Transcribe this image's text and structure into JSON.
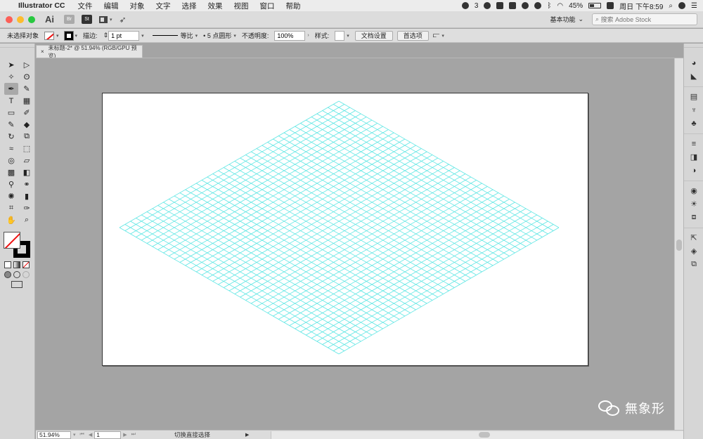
{
  "menubar": {
    "app_name": "Illustrator CC",
    "items": [
      "文件",
      "编辑",
      "对象",
      "文字",
      "选择",
      "效果",
      "视图",
      "窗口",
      "帮助"
    ],
    "wechat_count": "3",
    "battery": "45%",
    "clock": "周日 下午8:59"
  },
  "titlebar": {
    "app_badge": "Ai",
    "bridge_label": "Br",
    "stock_label": "St",
    "workspace": "基本功能",
    "search_placeholder": "搜索 Adobe Stock"
  },
  "controlbar": {
    "selection": "未选择对象",
    "stroke_label": "描边:",
    "stroke_weight": "1 pt",
    "profile": "等比",
    "brush": "5 点圆形",
    "opacity_label": "不透明度:",
    "opacity": "100%",
    "style_label": "样式:",
    "doc_setup": "文档设置",
    "preferences": "首选项"
  },
  "document": {
    "tab_title": "未标题-2* @ 51.94% (RGB/GPU 预览)",
    "close": "×"
  },
  "grid": {
    "color": "#5ee6e4",
    "divisions": 40
  },
  "watermark": {
    "text": "無象形"
  },
  "statusbar": {
    "zoom": "51.94%",
    "page": "1",
    "tool_hint": "切换直接选择"
  },
  "colors": {
    "canvas_bg": "#a4a4a4",
    "panel_bg": "#d6d6d6",
    "grid_line": "#5ee6e4"
  }
}
